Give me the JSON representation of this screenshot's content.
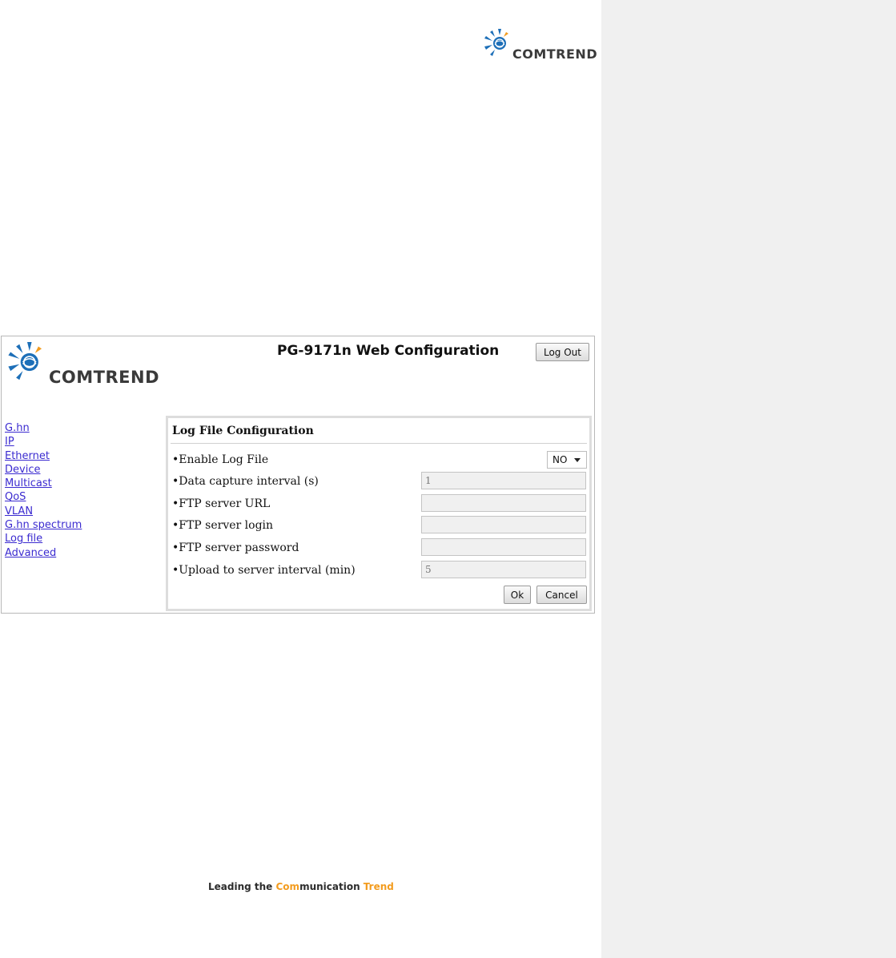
{
  "brand": {
    "name": "COMTREND",
    "colors": {
      "logo_blue": "#1d6fb8",
      "logo_text": "#3a3a3a",
      "accent_orange": "#f39c1f",
      "link": "#3b2bd0"
    }
  },
  "app": {
    "title": "PG-9171n Web Configuration",
    "logout_label": "Log Out"
  },
  "nav": {
    "items": [
      "G.hn",
      "IP",
      "Ethernet",
      "Device",
      "Multicast",
      "QoS",
      "VLAN",
      "G.hn spectrum",
      "Log file",
      "Advanced"
    ]
  },
  "panel": {
    "title": "Log File Configuration",
    "enable_label": "•Enable Log File",
    "enable_value": "NO",
    "fields": [
      {
        "label": "•Data capture interval (s)",
        "value": "1"
      },
      {
        "label": "•FTP server URL",
        "value": ""
      },
      {
        "label": "•FTP server login",
        "value": ""
      },
      {
        "label": "•FTP server password",
        "value": ""
      },
      {
        "label": "•Upload to server interval (min)",
        "value": "5"
      }
    ],
    "ok_label": "Ok",
    "cancel_label": "Cancel"
  },
  "footer": {
    "tag_part1": "Leading the ",
    "tag_part2": "Com",
    "tag_part3": "munication ",
    "tag_part4": "Trend"
  },
  "icons": [
    "comtrend-logo-icon",
    "chevron-down-icon"
  ]
}
